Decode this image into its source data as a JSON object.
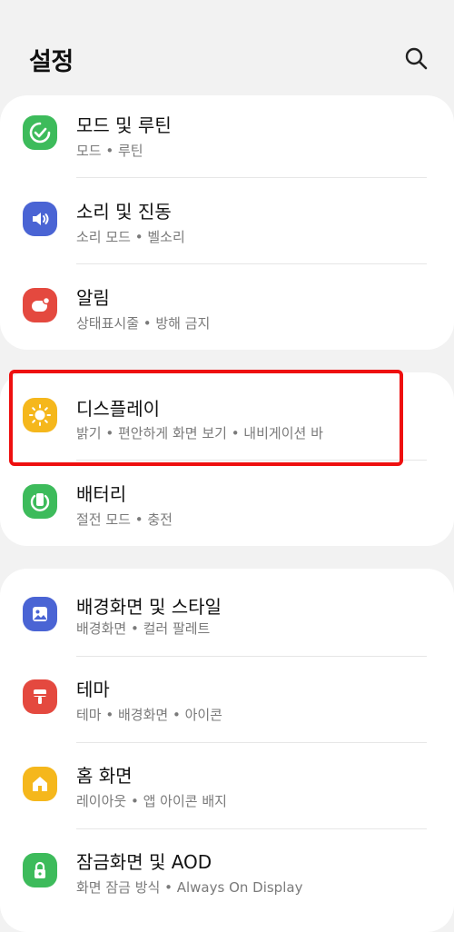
{
  "header": {
    "title": "설정",
    "search_icon": "search-icon"
  },
  "colors": {
    "background": "#f2f2f2",
    "card": "#ffffff",
    "highlight": "#ee0f0f",
    "green": "#3dbb5b",
    "blue": "#4a64d4",
    "red": "#e4493f",
    "yellow": "#f5b71c"
  },
  "groups": [
    {
      "items": [
        {
          "title": "모드 및 루틴",
          "subtitle": "모드  •  루틴",
          "icon": "check-circle-icon",
          "icon_color": "#3dbb5b"
        },
        {
          "title": "소리 및 진동",
          "subtitle": "소리 모드  •  벨소리",
          "icon": "speaker-icon",
          "icon_color": "#4a64d4"
        },
        {
          "title": "알림",
          "subtitle": "상태표시줄  •  방해 금지",
          "icon": "notification-icon",
          "icon_color": "#e4493f"
        }
      ]
    },
    {
      "items": [
        {
          "title": "디스플레이",
          "subtitle": "밝기  •  편안하게 화면 보기  •  내비게이션 바",
          "icon": "sun-icon",
          "icon_color": "#f5b71c",
          "highlighted": true
        },
        {
          "title": "배터리",
          "subtitle": "절전 모드  •  충전",
          "icon": "battery-icon",
          "icon_color": "#3dbb5b"
        }
      ]
    },
    {
      "items": [
        {
          "title": "배경화면 및 스타일",
          "subtitle": "배경화면  •  컬러 팔레트",
          "icon": "wallpaper-icon",
          "icon_color": "#4a64d4"
        },
        {
          "title": "테마",
          "subtitle": "테마  •  배경화면  •  아이콘",
          "icon": "theme-brush-icon",
          "icon_color": "#e4493f"
        },
        {
          "title": "홈 화면",
          "subtitle": "레이아웃  •  앱 아이콘 배지",
          "icon": "home-icon",
          "icon_color": "#f5b71c"
        },
        {
          "title": "잠금화면 및 AOD",
          "subtitle": "화면 잠금 방식  •  Always On Display",
          "icon": "lock-icon",
          "icon_color": "#3dbb5b"
        }
      ]
    }
  ]
}
